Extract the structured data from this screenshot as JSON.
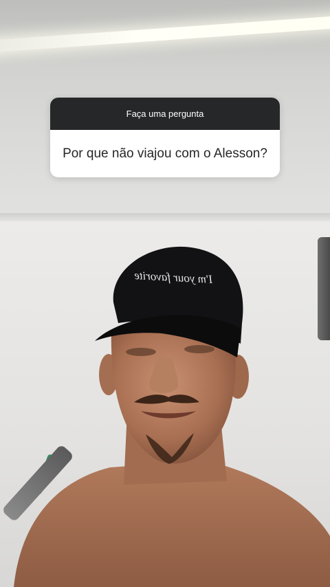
{
  "question_sticker": {
    "header": "Faça uma pergunta",
    "question": "Por que não viajou com o Alesson?"
  },
  "cap_text": "I'm your favorite",
  "colors": {
    "sticker_header_bg": "#262729",
    "sticker_body_bg": "#ffffff",
    "cap": "#121214",
    "skin": "#b07a5c"
  }
}
